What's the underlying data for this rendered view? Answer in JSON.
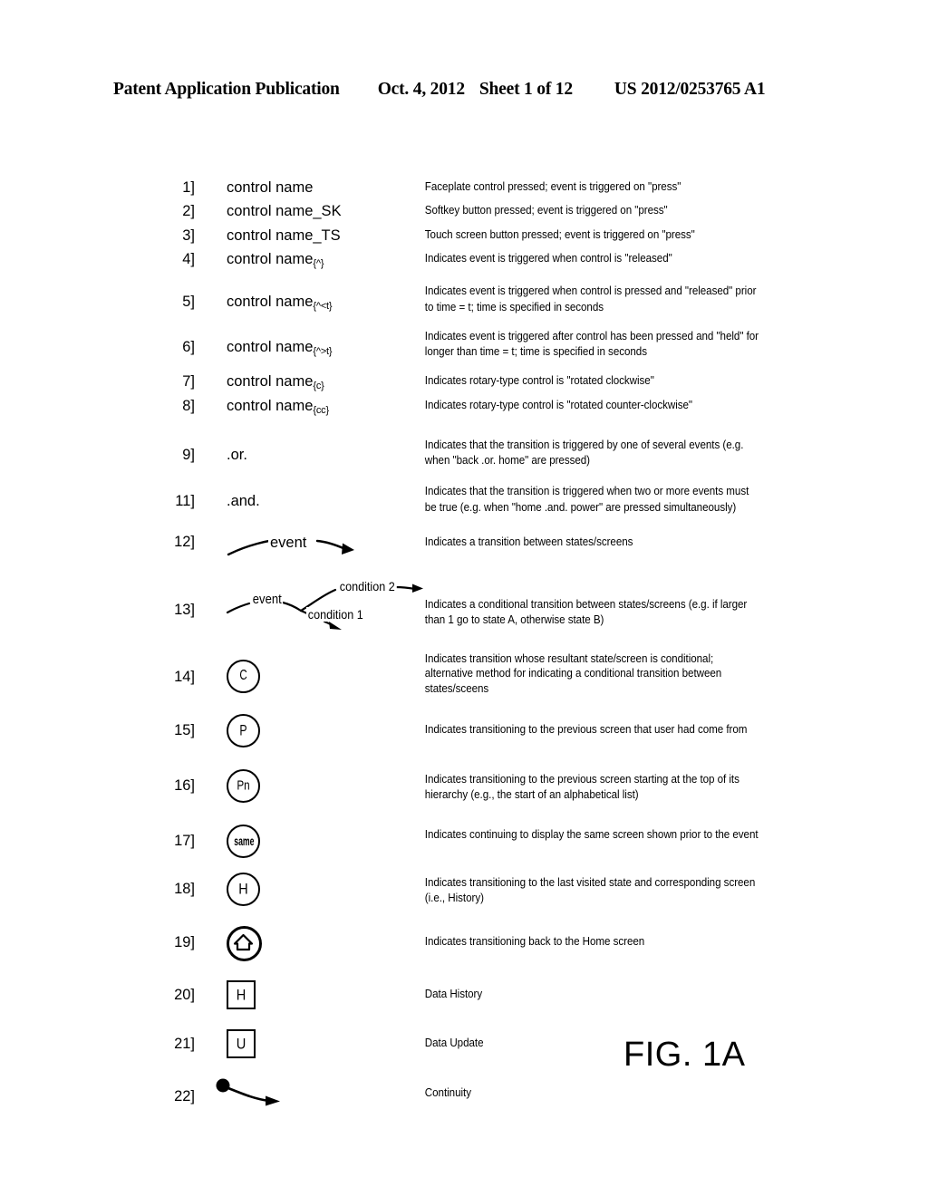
{
  "header": {
    "publication": "Patent Application Publication",
    "date": "Oct. 4, 2012",
    "sheet": "Sheet 1 of 12",
    "patent_number": "US 2012/0253765 A1"
  },
  "figure": {
    "label": "FIG. 1A"
  },
  "legend": {
    "rows": [
      {
        "num": "1]",
        "symbol_text": "control name",
        "symbol_sub": "",
        "symbol_kind": "text",
        "description": "Faceplate control pressed; event is triggered on \"press\""
      },
      {
        "num": "2]",
        "symbol_text": "control name_SK",
        "symbol_sub": "",
        "symbol_kind": "text",
        "description": "Softkey button pressed; event is triggered on \"press\""
      },
      {
        "num": "3]",
        "symbol_text": "control name_TS",
        "symbol_sub": "",
        "symbol_kind": "text",
        "description": "Touch screen button pressed; event is triggered on \"press\""
      },
      {
        "num": "4]",
        "symbol_text": "control name",
        "symbol_sub": "{^}",
        "symbol_kind": "text-sub",
        "description": "Indicates event is triggered when control is \"released\""
      },
      {
        "num": "5]",
        "symbol_text": "control name",
        "symbol_sub": "{^<t}",
        "symbol_kind": "text-sub",
        "description": "Indicates event is triggered when control is pressed and \"released\" prior to time = t; time is specified in seconds"
      },
      {
        "num": "6]",
        "symbol_text": "control name",
        "symbol_sub": "{^>t}",
        "symbol_kind": "text-sub",
        "description": "Indicates event is triggered after control has been pressed and \"held\" for longer than time = t; time is specified in seconds"
      },
      {
        "num": "7]",
        "symbol_text": "control name",
        "symbol_sub": "{c}",
        "symbol_kind": "text-sub",
        "description": "Indicates rotary-type control is \"rotated clockwise\""
      },
      {
        "num": "8]",
        "symbol_text": "control name",
        "symbol_sub": "{cc}",
        "symbol_kind": "text-sub",
        "description": "Indicates rotary-type control is \"rotated counter-clockwise\""
      },
      {
        "num": "9]",
        "symbol_text": ".or.",
        "symbol_sub": "",
        "symbol_kind": "text",
        "description": "Indicates that the transition is triggered by one of several events (e.g. when \"back .or. home\" are pressed)"
      },
      {
        "num": "11]",
        "symbol_text": ".and.",
        "symbol_sub": "",
        "symbol_kind": "text",
        "description": "Indicates that the transition is triggered when two or more events must be true (e.g. when \"home .and. power\" are pressed simultaneously)"
      },
      {
        "num": "12]",
        "symbol_text": "event",
        "symbol_sub": "",
        "symbol_kind": "event-arrow",
        "description": "Indicates a transition between states/screens"
      },
      {
        "num": "13]",
        "symbol_text": "event",
        "symbol_sub": "",
        "symbol_kind": "conditional-arrow",
        "label_condition_1": "condition 1",
        "label_condition_2": "condition 2",
        "description": "Indicates a conditional transition between states/screens (e.g. if larger than 1 go to state A, otherwise state B)"
      },
      {
        "num": "14]",
        "symbol_text": "C",
        "symbol_sub": "",
        "symbol_kind": "circle",
        "description": "Indicates transition whose resultant state/screen is conditional; alternative method for indicating a conditional transition between states/sceens"
      },
      {
        "num": "15]",
        "symbol_text": "P",
        "symbol_sub": "",
        "symbol_kind": "circle",
        "description": "Indicates transitioning to the previous screen that user had come from"
      },
      {
        "num": "16]",
        "symbol_text": "Pn",
        "symbol_sub": "",
        "symbol_kind": "circle",
        "description": "Indicates transitioning to the previous screen starting at the top of its hierarchy (e.g., the start of an alphabetical list)"
      },
      {
        "num": "17]",
        "symbol_text": "same",
        "symbol_sub": "",
        "symbol_kind": "circle",
        "description": "Indicates continuing to display the same screen shown prior to the event"
      },
      {
        "num": "18]",
        "symbol_text": "H",
        "symbol_sub": "",
        "symbol_kind": "circle",
        "description": "Indicates transitioning to the last visited state and corresponding screen (i.e., History)"
      },
      {
        "num": "19]",
        "symbol_text": "",
        "symbol_sub": "",
        "symbol_kind": "circle-home",
        "description": "Indicates transitioning back to the Home screen"
      },
      {
        "num": "20]",
        "symbol_text": "H",
        "symbol_sub": "",
        "symbol_kind": "square",
        "description": "Data History"
      },
      {
        "num": "21]",
        "symbol_text": "U",
        "symbol_sub": "",
        "symbol_kind": "square",
        "description": "Data Update"
      },
      {
        "num": "22]",
        "symbol_text": "",
        "symbol_sub": "",
        "symbol_kind": "continuity-arrow",
        "description": "Continuity"
      }
    ]
  }
}
